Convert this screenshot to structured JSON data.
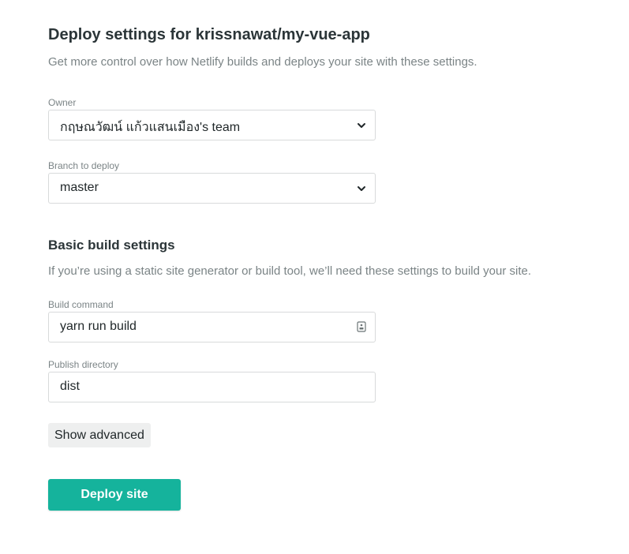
{
  "header": {
    "title": "Deploy settings for krissnawat/my-vue-app",
    "subtitle": "Get more control over how Netlify builds and deploys your site with these settings."
  },
  "owner": {
    "label": "Owner",
    "value": "กฤษณวัฒน์ แก้วแสนเมือง's team",
    "icon": "chevron-down-icon"
  },
  "branch": {
    "label": "Branch to deploy",
    "value": "master",
    "icon": "chevron-down-icon"
  },
  "build_settings": {
    "title": "Basic build settings",
    "subtitle": "If you’re using a static site generator or build tool, we’ll need these settings to build your site."
  },
  "build_command": {
    "label": "Build command",
    "value": "yarn run build",
    "icon": "document-icon"
  },
  "publish_directory": {
    "label": "Publish directory",
    "value": "dist"
  },
  "actions": {
    "show_advanced": "Show advanced",
    "deploy": "Deploy site"
  },
  "colors": {
    "primary": "#15b39c",
    "text": "#2b3538",
    "muted": "#7b8486",
    "border": "#d8dadb"
  }
}
